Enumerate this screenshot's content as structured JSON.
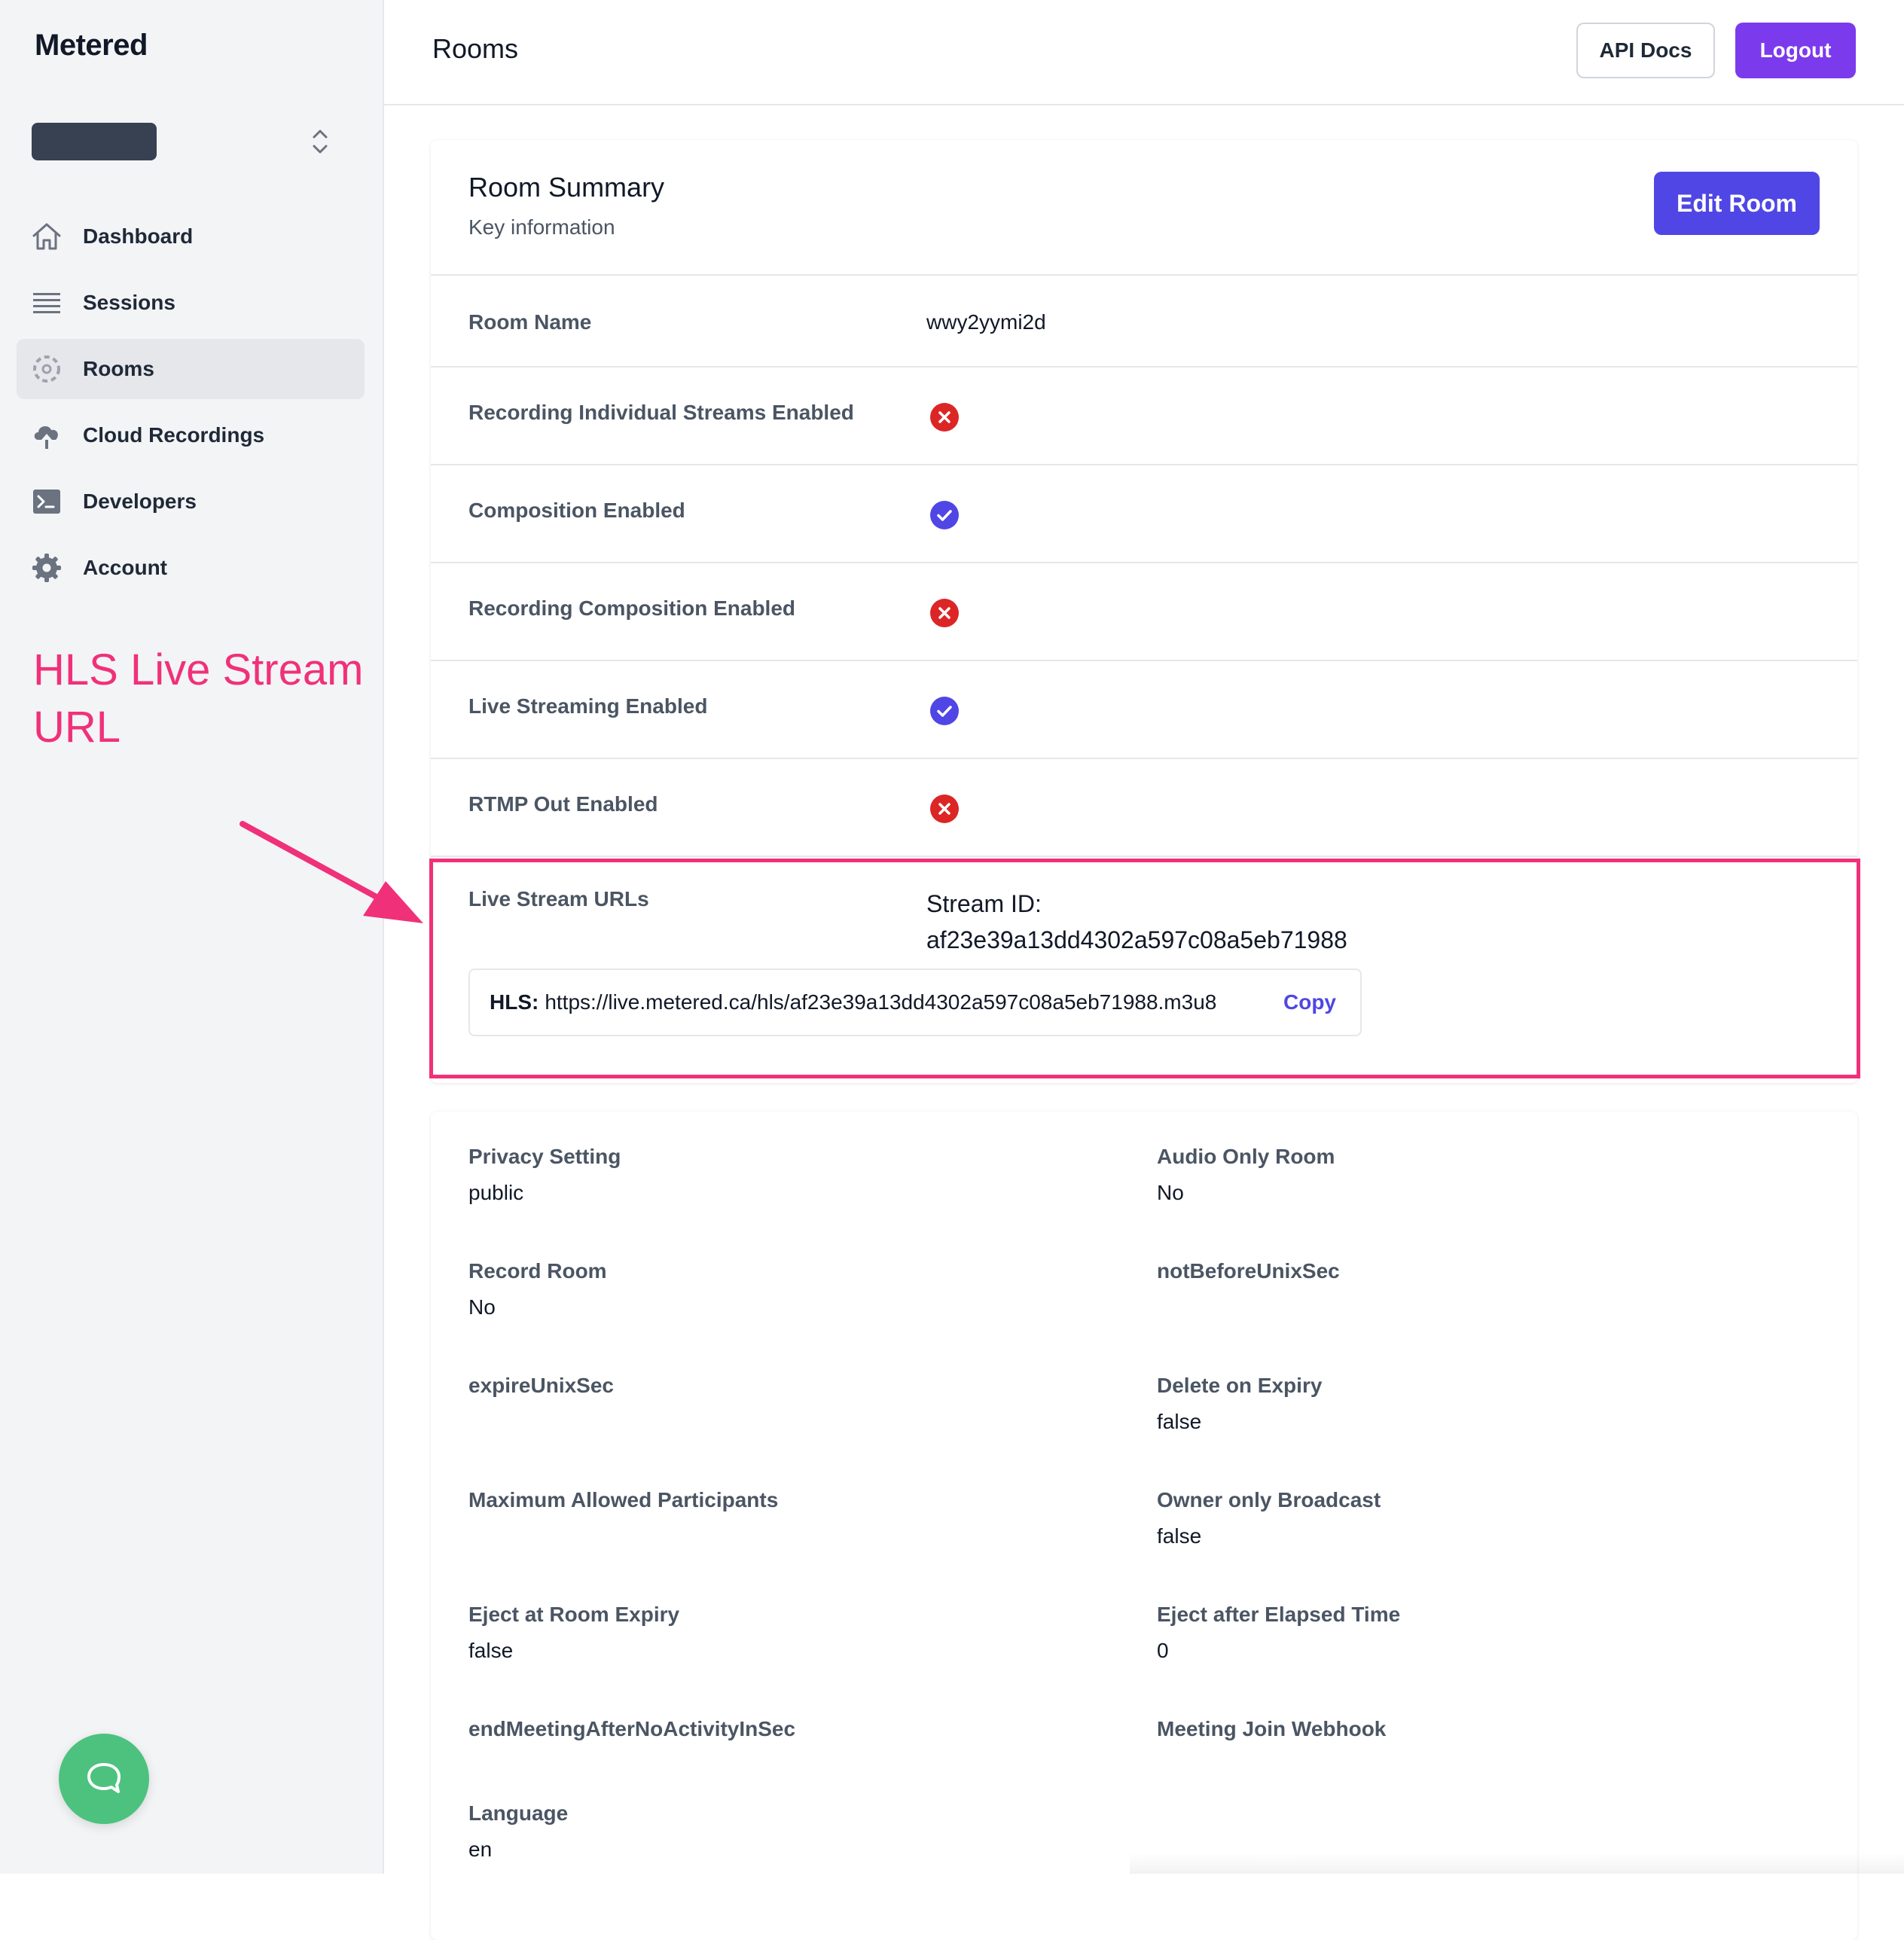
{
  "app": {
    "brand": "Metered"
  },
  "sidebar": {
    "items": [
      {
        "label": "Dashboard",
        "icon": "home-icon"
      },
      {
        "label": "Sessions",
        "icon": "list-icon"
      },
      {
        "label": "Rooms",
        "icon": "rooms-icon",
        "active": true
      },
      {
        "label": "Cloud Recordings",
        "icon": "cloud-upload-icon"
      },
      {
        "label": "Developers",
        "icon": "terminal-icon"
      },
      {
        "label": "Account",
        "icon": "gear-icon"
      }
    ]
  },
  "annotation": {
    "text": "HLS Live Stream URL",
    "color": "#f0317a"
  },
  "header": {
    "title": "Rooms",
    "api_docs": "API Docs",
    "logout": "Logout"
  },
  "summary": {
    "title": "Room Summary",
    "subtitle": "Key information",
    "edit_button": "Edit Room",
    "rows": [
      {
        "label": "Room Name",
        "value": "wwy2yymi2d"
      },
      {
        "label": "Recording Individual Streams Enabled",
        "status": "disabled"
      },
      {
        "label": "Composition Enabled",
        "status": "enabled"
      },
      {
        "label": "Recording Composition Enabled",
        "status": "disabled"
      },
      {
        "label": "Live Streaming Enabled",
        "status": "enabled"
      },
      {
        "label": "RTMP Out Enabled",
        "status": "disabled"
      }
    ],
    "live_stream": {
      "label": "Live Stream URLs",
      "stream_id_label": "Stream ID:",
      "stream_id": "af23e39a13dd4302a597c08a5eb71988",
      "hls_label": "HLS:",
      "hls_url": "https://live.metered.ca/hls/af23e39a13dd4302a597c08a5eb71988.m3u8",
      "copy_label": "Copy"
    }
  },
  "details": {
    "fields": [
      {
        "label": "Privacy Setting",
        "value": "public"
      },
      {
        "label": "Audio Only Room",
        "value": "No"
      },
      {
        "label": "Record Room",
        "value": "No"
      },
      {
        "label": "notBeforeUnixSec",
        "value": ""
      },
      {
        "label": "expireUnixSec",
        "value": ""
      },
      {
        "label": "Delete on Expiry",
        "value": "false"
      },
      {
        "label": "Maximum Allowed Participants",
        "value": ""
      },
      {
        "label": "Owner only Broadcast",
        "value": "false"
      },
      {
        "label": "Eject at Room Expiry",
        "value": "false"
      },
      {
        "label": "Eject after Elapsed Time",
        "value": "0"
      },
      {
        "label": "endMeetingAfterNoActivityInSec",
        "value": ""
      },
      {
        "label": "Meeting Join Webhook",
        "value": ""
      },
      {
        "label": "Language",
        "value": "en"
      }
    ]
  },
  "colors": {
    "primary": "#4f46e5",
    "logout": "#7c3aed",
    "enabled": "#4f46e5",
    "disabled": "#dc2626",
    "chat": "#4cc27e"
  }
}
